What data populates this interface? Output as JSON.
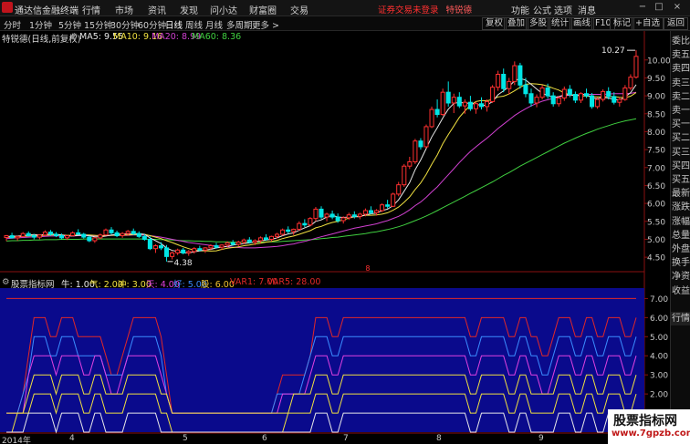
{
  "app_title": "通达信金融终端",
  "menu": [
    "行情",
    "市场",
    "资讯",
    "发现",
    "问小达",
    "财富圈",
    "交易"
  ],
  "notice": "证券交易未登录",
  "notice_stock": "特锐德",
  "right_menu": [
    "功能",
    "公式",
    "选项",
    "消息"
  ],
  "window_buttons": [
    "−",
    "□",
    "×"
  ],
  "periods": [
    "分时",
    "1分钟",
    "5分钟",
    "15分钟",
    "30分钟",
    "60分钟",
    "日线",
    "周线",
    "月线",
    "多周期",
    "更多 >"
  ],
  "active_period": "日线",
  "toolbar_right": [
    "复权",
    "叠加",
    "多股",
    "统计",
    "画线",
    "F10",
    "标记",
    "+自选",
    "返回"
  ],
  "main_header": {
    "stock_title": "特锐德(日线,前复权)",
    "ma5": "MA5: 9.55",
    "ma10": "MA10: 9.16",
    "ma20": "MA20: 8.99",
    "ma60": "MA60: 8.36"
  },
  "indicator_header": {
    "name": "股票指标网",
    "niu": "牛: 1.00",
    "qi": "气: 2.00",
    "chong": "冲: 3.00",
    "tian": "天: 4.00",
    "hao": "好: 5.00",
    "gu": "股: 6.00",
    "var1": "VAR1: 7.00",
    "var5": "VAR5: 28.00"
  },
  "annotations": {
    "high": "10.27",
    "low": "4.38",
    "marker": "8"
  },
  "price_axis": [
    "10.00",
    "9.50",
    "9.00",
    "8.50",
    "8.00",
    "7.50",
    "7.00",
    "6.50",
    "6.00",
    "5.50",
    "5.00",
    "4.50"
  ],
  "indicator_axis": [
    "7.00",
    "6.00",
    "5.00",
    "4.00",
    "3.00",
    "2.00",
    "1.00"
  ],
  "dates": [
    "2014年",
    "4",
    "5",
    "6",
    "7",
    "8",
    "9"
  ],
  "sidebar_tabs": [
    "委比",
    "卖五",
    "卖四",
    "卖三",
    "卖二",
    "卖一",
    "买一",
    "买二",
    "买三",
    "买四",
    "买五",
    "最新",
    "涨跌",
    "涨幅",
    "总量",
    "外盘",
    "换手",
    "净资",
    "收益",
    "",
    "行情"
  ],
  "watermark": {
    "line1": "股票指标网",
    "line2": "www.7gpzb.com"
  },
  "colors": {
    "up": "#ff3030",
    "down": "#00e5e5",
    "ma5": "#e8e8e8",
    "ma10": "#f0e040",
    "ma20": "#d040d0",
    "ma60": "#40d040",
    "indicator_bg": "#0a0a8c",
    "niu": "#e8e8e8",
    "qi": "#f0e040",
    "chong": "#f0e040",
    "tian": "#e040e0",
    "hao": "#3a8cff",
    "gu": "#f0c030",
    "var1": "#e02828",
    "var5": "#e02828"
  },
  "candles": [
    [
      5.05,
      5.12,
      4.95,
      5.1
    ],
    [
      5.1,
      5.18,
      5.02,
      5.04
    ],
    [
      5.04,
      5.1,
      4.96,
      5.08
    ],
    [
      5.08,
      5.2,
      5.05,
      5.16
    ],
    [
      5.16,
      5.22,
      5.08,
      5.1
    ],
    [
      5.1,
      5.15,
      5.0,
      5.06
    ],
    [
      5.06,
      5.14,
      5.0,
      5.12
    ],
    [
      5.12,
      5.25,
      5.1,
      5.2
    ],
    [
      5.2,
      5.26,
      5.1,
      5.14
    ],
    [
      5.14,
      5.2,
      5.06,
      5.1
    ],
    [
      5.1,
      5.16,
      5.0,
      5.04
    ],
    [
      5.04,
      5.12,
      4.98,
      5.1
    ],
    [
      5.1,
      5.22,
      5.08,
      5.18
    ],
    [
      5.18,
      5.28,
      5.12,
      5.14
    ],
    [
      5.14,
      5.18,
      5.02,
      5.06
    ],
    [
      5.06,
      5.1,
      4.92,
      4.96
    ],
    [
      4.96,
      5.06,
      4.9,
      5.04
    ],
    [
      5.04,
      5.16,
      5.0,
      5.12
    ],
    [
      5.12,
      5.3,
      5.1,
      5.26
    ],
    [
      5.26,
      5.34,
      5.14,
      5.18
    ],
    [
      5.18,
      5.24,
      5.06,
      5.1
    ],
    [
      5.1,
      5.2,
      5.04,
      5.16
    ],
    [
      5.16,
      5.26,
      5.1,
      5.22
    ],
    [
      5.22,
      5.3,
      5.12,
      5.16
    ],
    [
      5.16,
      5.22,
      5.04,
      5.08
    ],
    [
      5.08,
      5.14,
      4.96,
      5.0
    ],
    [
      5.0,
      5.08,
      4.7,
      4.74
    ],
    [
      4.74,
      4.86,
      4.62,
      4.82
    ],
    [
      4.82,
      4.92,
      4.7,
      4.76
    ],
    [
      4.76,
      4.84,
      4.38,
      4.52
    ],
    [
      4.52,
      4.66,
      4.44,
      4.62
    ],
    [
      4.62,
      4.74,
      4.56,
      4.7
    ],
    [
      4.7,
      4.76,
      4.58,
      4.62
    ],
    [
      4.62,
      4.7,
      4.54,
      4.66
    ],
    [
      4.66,
      4.78,
      4.6,
      4.74
    ],
    [
      4.74,
      4.82,
      4.66,
      4.7
    ],
    [
      4.7,
      4.78,
      4.62,
      4.76
    ],
    [
      4.76,
      4.86,
      4.7,
      4.82
    ],
    [
      4.82,
      4.9,
      4.74,
      4.78
    ],
    [
      4.78,
      4.86,
      4.7,
      4.84
    ],
    [
      4.84,
      4.94,
      4.78,
      4.9
    ],
    [
      4.9,
      4.98,
      4.82,
      4.86
    ],
    [
      4.86,
      4.96,
      4.8,
      4.92
    ],
    [
      4.92,
      5.02,
      4.86,
      4.98
    ],
    [
      4.98,
      5.06,
      4.88,
      4.92
    ],
    [
      4.92,
      5.0,
      4.84,
      4.96
    ],
    [
      4.96,
      5.08,
      4.9,
      5.04
    ],
    [
      5.04,
      5.14,
      4.96,
      5.0
    ],
    [
      5.0,
      5.1,
      4.94,
      5.08
    ],
    [
      5.08,
      5.18,
      5.02,
      5.14
    ],
    [
      5.14,
      5.3,
      5.1,
      5.26
    ],
    [
      5.26,
      5.36,
      5.16,
      5.22
    ],
    [
      5.22,
      5.3,
      5.12,
      5.28
    ],
    [
      5.28,
      5.5,
      5.24,
      5.44
    ],
    [
      5.44,
      5.56,
      5.34,
      5.4
    ],
    [
      5.4,
      5.62,
      5.36,
      5.58
    ],
    [
      5.58,
      5.9,
      5.5,
      5.84
    ],
    [
      5.84,
      5.92,
      5.56,
      5.62
    ],
    [
      5.62,
      5.74,
      5.5,
      5.7
    ],
    [
      5.7,
      5.8,
      5.56,
      5.62
    ],
    [
      5.62,
      5.72,
      5.46,
      5.52
    ],
    [
      5.52,
      5.64,
      5.44,
      5.6
    ],
    [
      5.6,
      5.74,
      5.54,
      5.68
    ],
    [
      5.68,
      5.78,
      5.58,
      5.64
    ],
    [
      5.64,
      5.74,
      5.56,
      5.7
    ],
    [
      5.7,
      5.86,
      5.64,
      5.8
    ],
    [
      5.8,
      5.92,
      5.7,
      5.74
    ],
    [
      5.74,
      5.84,
      5.66,
      5.8
    ],
    [
      5.8,
      6.0,
      5.76,
      5.96
    ],
    [
      5.96,
      6.1,
      5.86,
      5.92
    ],
    [
      5.92,
      6.3,
      5.9,
      6.26
    ],
    [
      6.26,
      6.6,
      6.2,
      6.52
    ],
    [
      6.52,
      7.1,
      6.46,
      7.04
    ],
    [
      7.04,
      7.3,
      6.96,
      7.16
    ],
    [
      7.16,
      7.8,
      7.1,
      7.74
    ],
    [
      7.74,
      7.82,
      7.5,
      7.58
    ],
    [
      7.58,
      8.2,
      7.54,
      8.14
    ],
    [
      8.14,
      8.7,
      8.1,
      8.62
    ],
    [
      8.62,
      8.9,
      8.4,
      8.48
    ],
    [
      8.48,
      9.2,
      8.44,
      9.1
    ],
    [
      9.1,
      9.4,
      8.7,
      8.8
    ],
    [
      8.8,
      9.06,
      8.52,
      8.96
    ],
    [
      8.96,
      9.1,
      8.66,
      8.72
    ],
    [
      8.72,
      8.9,
      8.5,
      8.82
    ],
    [
      8.82,
      9.0,
      8.58,
      8.64
    ],
    [
      8.64,
      8.84,
      8.5,
      8.78
    ],
    [
      8.78,
      8.96,
      8.62,
      8.7
    ],
    [
      8.7,
      8.9,
      8.56,
      8.84
    ],
    [
      8.84,
      9.3,
      8.8,
      9.24
    ],
    [
      9.24,
      9.7,
      9.14,
      9.6
    ],
    [
      9.6,
      9.76,
      9.1,
      9.2
    ],
    [
      9.2,
      9.5,
      9.04,
      9.4
    ],
    [
      9.4,
      9.96,
      9.3,
      9.84
    ],
    [
      9.84,
      9.92,
      9.2,
      9.3
    ],
    [
      9.3,
      9.5,
      8.96,
      9.06
    ],
    [
      9.06,
      9.2,
      8.7,
      8.8
    ],
    [
      8.8,
      9.04,
      8.68,
      8.96
    ],
    [
      8.96,
      9.3,
      8.9,
      9.22
    ],
    [
      9.22,
      9.34,
      8.92,
      9.0
    ],
    [
      9.0,
      9.1,
      8.7,
      8.78
    ],
    [
      8.78,
      9.0,
      8.7,
      8.94
    ],
    [
      8.94,
      9.26,
      8.86,
      9.18
    ],
    [
      9.18,
      9.3,
      8.96,
      9.04
    ],
    [
      9.04,
      9.12,
      8.8,
      8.88
    ],
    [
      8.88,
      9.1,
      8.8,
      9.06
    ],
    [
      9.06,
      9.2,
      8.94,
      9.0
    ],
    [
      9.0,
      9.08,
      8.64,
      8.7
    ],
    [
      8.7,
      8.96,
      8.64,
      8.9
    ],
    [
      8.9,
      9.18,
      8.84,
      9.12
    ],
    [
      9.12,
      9.24,
      8.9,
      8.98
    ],
    [
      8.98,
      9.1,
      8.76,
      8.82
    ],
    [
      8.82,
      8.96,
      8.7,
      8.9
    ],
    [
      8.9,
      9.3,
      8.86,
      9.22
    ],
    [
      9.22,
      9.6,
      9.16,
      9.52
    ],
    [
      9.52,
      10.27,
      9.48,
      10.1
    ]
  ],
  "ma_lines": {
    "ma5": [
      5.07,
      5.08,
      5.09,
      5.1,
      5.12,
      5.13,
      5.12,
      5.13,
      5.15,
      5.14,
      5.12,
      5.1,
      5.09,
      5.11,
      5.12,
      5.1,
      5.07,
      5.07,
      5.09,
      5.12,
      5.14,
      5.15,
      5.15,
      5.16,
      5.16,
      5.14,
      5.04,
      4.96,
      4.88,
      4.76,
      4.69,
      4.66,
      4.62,
      4.62,
      4.65,
      4.68,
      4.7,
      4.72,
      4.76,
      4.78,
      4.8,
      4.84,
      4.86,
      4.88,
      4.9,
      4.93,
      4.95,
      4.98,
      5.0,
      5.04,
      5.1,
      5.15,
      5.18,
      5.25,
      5.32,
      5.38,
      5.5,
      5.54,
      5.62,
      5.67,
      5.62,
      5.61,
      5.62,
      5.63,
      5.63,
      5.68,
      5.71,
      5.73,
      5.8,
      5.84,
      5.94,
      6.1,
      6.34,
      6.58,
      6.94,
      7.21,
      7.53,
      7.85,
      8.11,
      8.38,
      8.63,
      8.79,
      8.82,
      8.8,
      8.79,
      8.77,
      8.73,
      8.74,
      8.84,
      9.03,
      9.14,
      9.26,
      9.42,
      9.48,
      9.44,
      9.32,
      9.19,
      9.07,
      9.01,
      8.95,
      8.98,
      9.02,
      9.03,
      9.0,
      9.02,
      9.05,
      8.94,
      8.92,
      8.96,
      8.94,
      8.9,
      8.88,
      8.97,
      9.09,
      9.31
    ],
    "ma10": [
      5.05,
      5.06,
      5.07,
      5.08,
      5.09,
      5.1,
      5.1,
      5.11,
      5.12,
      5.12,
      5.12,
      5.11,
      5.11,
      5.12,
      5.12,
      5.12,
      5.11,
      5.1,
      5.1,
      5.11,
      5.12,
      5.12,
      5.12,
      5.13,
      5.14,
      5.14,
      5.1,
      5.06,
      5.02,
      4.96,
      4.91,
      4.85,
      4.79,
      4.74,
      4.7,
      4.68,
      4.68,
      4.67,
      4.68,
      4.72,
      4.75,
      4.77,
      4.79,
      4.82,
      4.84,
      4.87,
      4.89,
      4.92,
      4.94,
      4.97,
      5.02,
      5.06,
      5.09,
      5.14,
      5.19,
      5.24,
      5.32,
      5.36,
      5.42,
      5.47,
      5.5,
      5.54,
      5.59,
      5.63,
      5.65,
      5.67,
      5.67,
      5.68,
      5.7,
      5.74,
      5.81,
      5.9,
      6.03,
      6.18,
      6.39,
      6.57,
      6.81,
      7.09,
      7.35,
      7.66,
      7.92,
      8.16,
      8.4,
      8.58,
      8.74,
      8.84,
      8.87,
      8.86,
      8.9,
      8.97,
      8.99,
      9.05,
      9.14,
      9.24,
      9.32,
      9.34,
      9.33,
      9.31,
      9.27,
      9.21,
      9.16,
      9.08,
      9.03,
      9.02,
      9.0,
      8.99,
      8.98,
      8.97,
      8.97,
      8.98,
      8.98,
      8.96,
      8.95,
      8.99,
      9.09
    ],
    "ma20": [
      5.02,
      5.03,
      5.04,
      5.05,
      5.06,
      5.07,
      5.07,
      5.08,
      5.09,
      5.09,
      5.09,
      5.09,
      5.09,
      5.1,
      5.1,
      5.1,
      5.1,
      5.1,
      5.1,
      5.11,
      5.11,
      5.11,
      5.11,
      5.12,
      5.12,
      5.12,
      5.1,
      5.08,
      5.06,
      5.03,
      5.0,
      4.97,
      4.94,
      4.91,
      4.89,
      4.87,
      4.85,
      4.83,
      4.81,
      4.8,
      4.79,
      4.78,
      4.77,
      4.76,
      4.76,
      4.76,
      4.77,
      4.78,
      4.79,
      4.8,
      4.82,
      4.85,
      4.87,
      4.91,
      4.94,
      4.98,
      5.03,
      5.07,
      5.11,
      5.15,
      5.19,
      5.23,
      5.27,
      5.31,
      5.34,
      5.37,
      5.4,
      5.43,
      5.48,
      5.52,
      5.58,
      5.64,
      5.72,
      5.82,
      5.94,
      6.04,
      6.17,
      6.32,
      6.46,
      6.63,
      6.8,
      6.97,
      7.14,
      7.3,
      7.45,
      7.58,
      7.7,
      7.82,
      7.95,
      8.09,
      8.21,
      8.33,
      8.45,
      8.55,
      8.64,
      8.72,
      8.79,
      8.85,
      8.89,
      8.93,
      8.97,
      9.0,
      9.02,
      9.02,
      9.03,
      9.04,
      9.04,
      9.04,
      9.04,
      9.05,
      9.06,
      9.06,
      9.06,
      9.07,
      9.1
    ],
    "ma60": [
      4.95,
      4.96,
      4.96,
      4.97,
      4.97,
      4.98,
      4.98,
      4.99,
      4.99,
      4.99,
      5.0,
      5.0,
      5.0,
      5.0,
      5.01,
      5.01,
      5.01,
      5.01,
      5.01,
      5.01,
      5.01,
      5.01,
      5.01,
      5.01,
      5.01,
      5.01,
      5.0,
      5.0,
      4.99,
      4.99,
      4.98,
      4.97,
      4.96,
      4.96,
      4.95,
      4.95,
      4.94,
      4.94,
      4.93,
      4.93,
      4.93,
      4.92,
      4.92,
      4.92,
      4.92,
      4.92,
      4.92,
      4.93,
      4.93,
      4.93,
      4.94,
      4.95,
      4.96,
      4.97,
      4.98,
      4.99,
      5.0,
      5.02,
      5.03,
      5.05,
      5.06,
      5.08,
      5.1,
      5.12,
      5.14,
      5.16,
      5.19,
      5.21,
      5.24,
      5.27,
      5.31,
      5.35,
      5.4,
      5.46,
      5.52,
      5.58,
      5.65,
      5.72,
      5.8,
      5.88,
      5.96,
      6.04,
      6.12,
      6.2,
      6.28,
      6.36,
      6.44,
      6.52,
      6.6,
      6.69,
      6.78,
      6.86,
      6.95,
      7.04,
      7.12,
      7.2,
      7.28,
      7.36,
      7.44,
      7.52,
      7.6,
      7.68,
      7.75,
      7.82,
      7.89,
      7.95,
      8.01,
      8.07,
      8.12,
      8.17,
      8.22,
      8.26,
      8.3,
      8.33,
      8.36
    ]
  },
  "ind_tracks": {
    "var1": "7 7 7 7 7 7 7 7 7 7 7 7 7 7 7 7 7 7 7 7 7 7 7 7 7 7 7 7 7 7 7 7 7 7 7 7 7 7 7 7 7 7 7 7 7 7 7 7 7 7 7 7 7 7 7 7 7 7 7 7 7 7 7 7 7 7 7 7 7 7 7 7 7 7 7 7 7 7 7 7 7 7 7 7 7 7 7 7 7 7 7 7 7 7 7 7 7 7 7 7 7 7 7 7 7 7 7 7 7 7 7 7 7 7 7",
    "gu": "1 1 1 2 4 6 6 6 5 5 6 6 6 5 5 5 5 5 4 3 3 4 5 6 6 6 6 6 5 3 1 1 1 1 1 1 1 1 1 1 1 1 1 1 1 1 1 1 1 2 3 3 3 3 3 4 6 6 6 5 5 6 6 6 6 6 6 6 6 6 6 6 6 6 6 6 6 6 6 6 6 6 6 6 5 5 6 6 6 6 6 5 5 6 6 5 5 4 4 5 6 6 6 5 5 6 6 5 5 6 6 6 5 5 6",
    "hao": "1 1 1 2 3 5 5 5 4 4 5 5 5 4 4 4 4 4 3 3 3 3 4 5 5 5 5 5 4 2 1 1 1 1 1 1 1 1 1 1 1 1 1 1 1 1 1 1 1 2 2 2 2 2 3 4 5 5 5 4 4 5 5 5 5 5 5 5 5 5 5 5 5 5 5 5 5 5 5 5 5 5 5 5 4 4 5 5 5 5 5 4 4 5 5 4 4 3 3 4 5 5 5 4 4 5 5 4 4 5 5 5 4 4 5",
    "tian": "1 1 1 1 3 4 4 4 4 3 4 4 4 4 3 3 4 4 3 2 2 3 4 4 4 4 4 4 3 2 1 1 1 1 1 1 1 1 1 1 1 1 1 1 1 1 1 1 1 1 2 2 2 2 2 3 4 4 4 3 3 4 4 4 4 4 4 4 4 4 4 4 4 4 4 4 4 4 4 4 4 4 4 4 3 3 4 4 4 4 4 3 3 4 4 3 3 2 2 3 4 4 4 3 3 4 4 3 3 4 4 4 3 3 4",
    "chong": "1 1 1 1 2 3 3 3 3 2 3 3 3 3 2 2 3 3 2 2 2 2 3 3 3 3 3 3 2 2 1 1 1 1 1 1 1 1 1 1 1 1 1 1 1 1 1 1 1 1 1 1 2 2 2 2 3 3 3 2 2 3 3 3 3 3 3 3 3 3 3 3 3 3 3 3 3 3 3 3 3 3 3 3 2 2 3 3 3 3 3 2 2 3 3 2 2 2 2 2 3 3 3 2 2 3 3 2 2 3 3 3 2 2 3",
    "qi": "0 0 1 1 1 2 2 2 2 1 2 2 2 2 1 1 2 2 1 1 1 1 2 2 2 2 2 2 1 1 0 0 0 0 0 0 0 0 0 0 0 0 0 0 0 0 0 0 0 0 0 1 1 1 1 1 2 2 2 1 1 2 2 2 2 2 2 2 2 2 2 2 2 2 2 2 2 2 2 2 2 2 2 2 1 1 2 2 2 2 2 1 1 2 2 1 1 1 1 1 2 2 2 1 1 2 2 1 1 2 2 2 1 1 2",
    "niu": "0 0 0 0 1 1 1 1 1 0 1 1 1 1 0 0 1 1 0 0 0 0 1 1 1 1 1 1 0 0 0 0 0 0 0 0 0 0 0 0 0 0 0 0 0 0 0 0 0 0 0 0 0 0 0 0 1 1 1 0 0 1 1 1 1 1 1 1 1 1 1 1 1 1 1 1 1 1 1 1 1 1 1 1 0 0 1 1 1 1 1 0 0 1 1 0 0 0 0 0 1 1 1 0 0 1 1 0 0 1 1 1 0 0 1"
  }
}
